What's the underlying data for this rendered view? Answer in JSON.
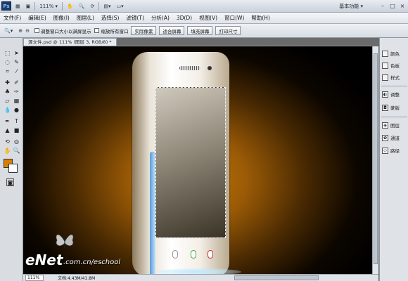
{
  "app": {
    "logo": "Ps",
    "zoom": "111%",
    "workspace": "基本功能"
  },
  "menu": [
    "文件(F)",
    "编辑(E)",
    "图像(I)",
    "图层(L)",
    "选择(S)",
    "滤镜(T)",
    "分析(A)",
    "3D(D)",
    "视图(V)",
    "窗口(W)",
    "帮助(H)"
  ],
  "options": {
    "resize_windows": "调整窗口大小以满屏显示",
    "zoom_all": "缩放所有窗口",
    "actual_pixels": "实际像素",
    "fit_screen": "适合屏幕",
    "fill_screen": "填充屏幕",
    "print_size": "打印尺寸"
  },
  "document": {
    "tab": "源文件.psd @ 111% (图层 3, RGB/8) *"
  },
  "status": {
    "zoom": "111%",
    "doc": "文档:4.43M/41.8M"
  },
  "panels": [
    "颜色",
    "色板",
    "样式",
    "调整",
    "蒙版",
    "图层",
    "通道",
    "路径"
  ],
  "watermark": {
    "brand": "eNet",
    "url": ".com.cn/eschool"
  },
  "colors": {
    "foreground": "#d97f06",
    "background": "#ffffff"
  }
}
